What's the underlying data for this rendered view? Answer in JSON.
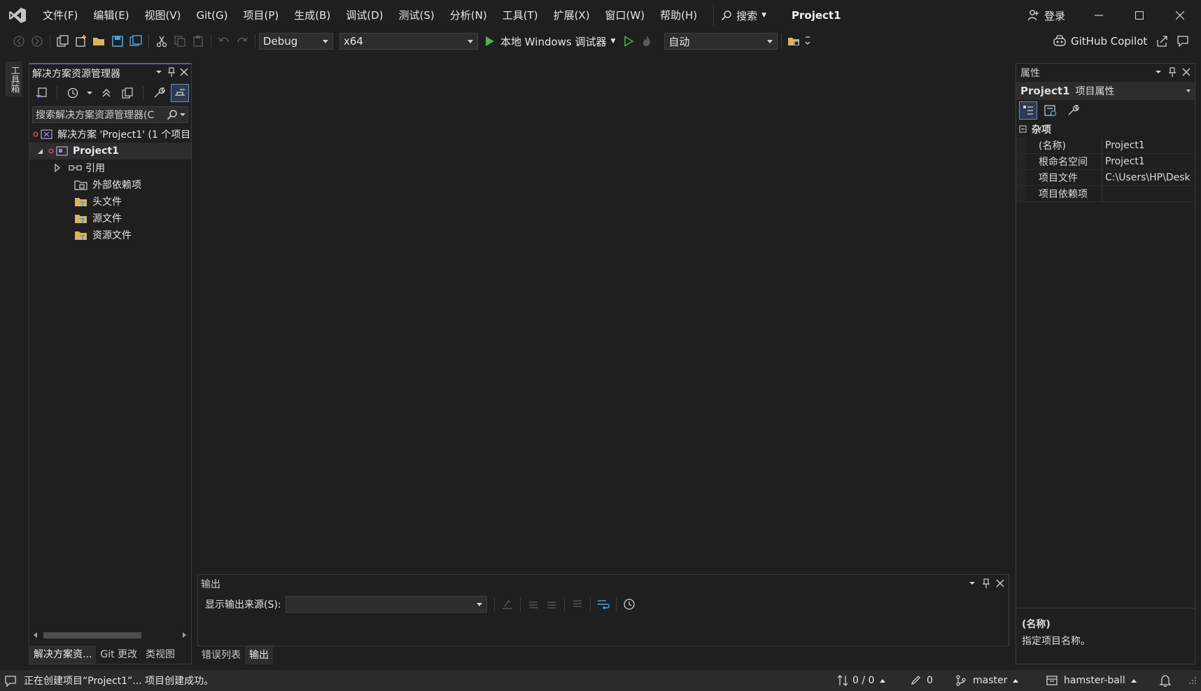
{
  "menu": {
    "items": [
      "文件(F)",
      "编辑(E)",
      "视图(V)",
      "Git(G)",
      "项目(P)",
      "生成(B)",
      "调试(D)",
      "测试(S)",
      "分析(N)",
      "工具(T)",
      "扩展(X)",
      "窗口(W)",
      "帮助(H)"
    ],
    "search_label": "搜索",
    "project_title": "Project1",
    "login_label": "登录"
  },
  "toolbar": {
    "config": "Debug",
    "platform": "x64",
    "run_label": "本地 Windows 调试器",
    "auto_combo": "自动",
    "copilot_label": "GitHub Copilot"
  },
  "toolbox_tab": "工具箱",
  "solution_explorer": {
    "title": "解决方案资源管理器",
    "search_placeholder": "搜索解决方案资源管理器(C",
    "tree": [
      {
        "label": "解决方案 'Project1' (1 个项目",
        "level": 0
      },
      {
        "label": "Project1",
        "level": 1,
        "bold": true,
        "selected": true
      },
      {
        "label": "引用",
        "level": 2,
        "expander": true
      },
      {
        "label": "外部依赖项",
        "level": 2
      },
      {
        "label": "头文件",
        "level": 2
      },
      {
        "label": "源文件",
        "level": 2
      },
      {
        "label": "资源文件",
        "level": 2
      }
    ],
    "bottom_tabs": [
      "解决方案资...",
      "Git 更改",
      "类视图"
    ]
  },
  "output": {
    "title": "输出",
    "source_label": "显示输出来源(S):",
    "source_value": "",
    "tabs": [
      "错误列表",
      "输出"
    ]
  },
  "properties": {
    "title": "属性",
    "object_name": "Project1",
    "object_type": "项目属性",
    "category": "杂项",
    "rows": [
      {
        "key": "(名称)",
        "value": "Project1"
      },
      {
        "key": "根命名空间",
        "value": "Project1"
      },
      {
        "key": "项目文件",
        "value": "C:\\Users\\HP\\Desk"
      },
      {
        "key": "项目依赖项",
        "value": ""
      }
    ],
    "desc_name": "(名称)",
    "desc_text": "指定项目名称。"
  },
  "status": {
    "message": "正在创建项目“Project1”... 项目创建成功。",
    "sync": "0 / 0",
    "edits": "0",
    "branch": "master",
    "repo": "hamster-ball"
  },
  "colors": {
    "accent": "#6c4ac9",
    "run_green": "#3fb950",
    "background": "#1f1f1f"
  }
}
